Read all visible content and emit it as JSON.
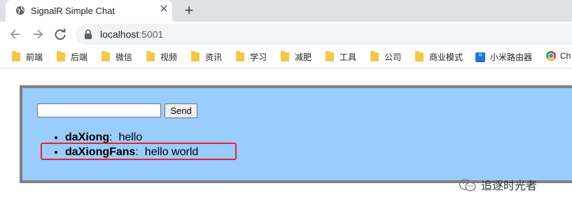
{
  "browser": {
    "tab": {
      "title": "SignalR Simple Chat",
      "close": "✕"
    },
    "new_tab": "+",
    "url": {
      "host": "localhost",
      "port": ":5001"
    },
    "bookmarks": [
      {
        "label": "前端",
        "icon": "folder-icon"
      },
      {
        "label": "后端",
        "icon": "folder-icon"
      },
      {
        "label": "微信",
        "icon": "folder-icon"
      },
      {
        "label": "视频",
        "icon": "folder-icon"
      },
      {
        "label": "资讯",
        "icon": "folder-icon"
      },
      {
        "label": "学习",
        "icon": "folder-icon"
      },
      {
        "label": "减肥",
        "icon": "folder-icon"
      },
      {
        "label": "工具",
        "icon": "folder-icon"
      },
      {
        "label": "公司",
        "icon": "folder-icon"
      },
      {
        "label": "商业模式",
        "icon": "folder-icon"
      },
      {
        "label": "小米路由器",
        "icon": "wifi-icon"
      },
      {
        "label": "Ch",
        "icon": "chrome-icon"
      }
    ]
  },
  "chat": {
    "input_value": "",
    "send_label": "Send",
    "messages": [
      {
        "user": "daXiong",
        "sep": ":",
        "text": "hello"
      },
      {
        "user": "daXiongFans",
        "sep": ":",
        "text": "hello world"
      }
    ]
  },
  "watermark": {
    "text": "追逐时光者"
  },
  "colors": {
    "panel_bg": "#99ccff",
    "panel_border": "#808080",
    "highlight": "#e8222b",
    "tab_strip": "#dee1e6"
  }
}
